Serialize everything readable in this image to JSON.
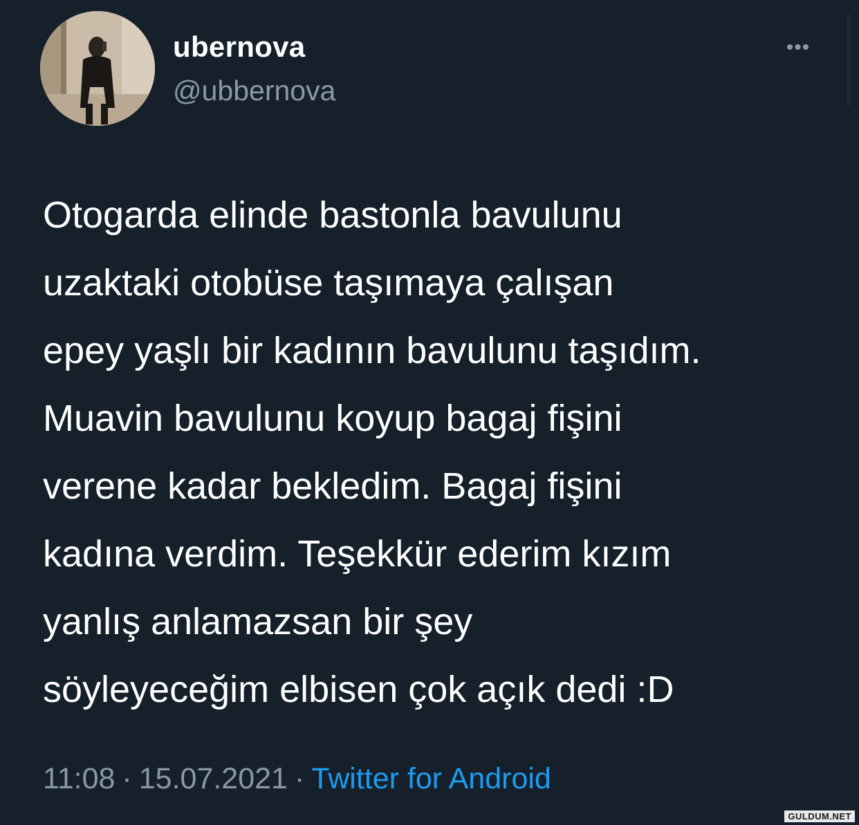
{
  "user": {
    "display_name": "ubernova",
    "handle": "@ubbernova"
  },
  "tweet": {
    "text": "Otogarda elinde bastonla bavulunu\nuzaktaki otobüse taşımaya çalışan\nepey yaşlı bir kadının bavulunu taşıdım.\nMuavin bavulunu koyup bagaj fişini\nverene kadar bekledim. Bagaj fişini\nkadına verdim. Teşekkür ederim kızım\nyanlış anlamazsan bir şey\nsöyleyeceğim elbisen çok açık dedi :D",
    "time": "11:08",
    "separator": "·",
    "date": "15.07.2021",
    "source": "Twitter for Android"
  },
  "more_button": {
    "label": "•••",
    "icon": "more-horizontal-icon"
  },
  "watermark": "GULDUM.NET",
  "colors": {
    "background": "#15202b",
    "text_primary": "#ffffff",
    "text_secondary": "#8b98a5",
    "accent": "#1d9bf0"
  }
}
